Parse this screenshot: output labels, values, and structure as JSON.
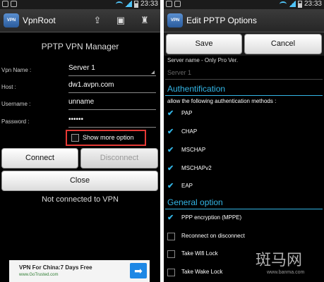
{
  "left": {
    "status_time": "23:33",
    "app_title": "VpnRoot",
    "app_icon_text": "VPN",
    "heading": "PPTP VPN Manager",
    "fields": [
      {
        "label": "Vpn Name :",
        "value": "Server 1"
      },
      {
        "label": "Host :",
        "value": "dw1.avpn.com"
      },
      {
        "label": "Username :",
        "value": "unname"
      },
      {
        "label": "Password :",
        "value": "••••••"
      }
    ],
    "show_more_label": "Show more option",
    "connect_label": "Connect",
    "disconnect_label": "Disconnect",
    "close_label": "Close",
    "status_text": "Not connected to VPN",
    "ad": {
      "title": "VPN For China:7 Days Free",
      "url": "www.GoTrusted.com"
    }
  },
  "right": {
    "status_time": "23:33",
    "app_title": "Edit PPTP Options",
    "app_icon_text": "VPN",
    "save_label": "Save",
    "cancel_label": "Cancel",
    "server_hint": "Server name - Only Pro Ver.",
    "server_placeholder": "Server 1",
    "auth_title": "Authentification",
    "auth_desc": "allow the following authentication methods :",
    "auth_methods": [
      {
        "label": "PAP",
        "checked": true
      },
      {
        "label": "CHAP",
        "checked": true
      },
      {
        "label": "MSCHAP",
        "checked": true
      },
      {
        "label": "MSCHAPv2",
        "checked": true
      },
      {
        "label": "EAP",
        "checked": true
      }
    ],
    "general_title": "General option",
    "general_options": [
      {
        "label": "PPP encryption (MPPE)",
        "checked": true
      },
      {
        "label": "Reconnect on disconnect",
        "checked": false
      },
      {
        "label": "Take Wifi Lock",
        "checked": false
      },
      {
        "label": "Take Wake Lock",
        "checked": false
      }
    ]
  },
  "watermark": {
    "text": "斑马网",
    "url": "www.banma.com"
  },
  "colors": {
    "accent": "#33b5e5",
    "highlight": "#e53935",
    "background": "#000000"
  }
}
